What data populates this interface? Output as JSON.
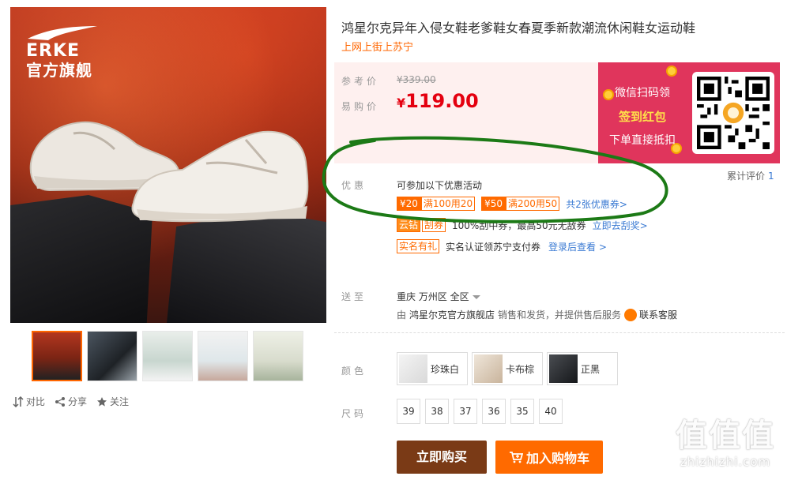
{
  "gallery": {
    "brand_name": "ERKE",
    "brand_flagship": "官方旗舰",
    "thumbnail_count": 5,
    "selected_thumbnail": 1
  },
  "actions": {
    "compare": "对比",
    "share": "分享",
    "follow": "关注"
  },
  "product": {
    "title": "鸿星尔克异年入侵女鞋老爹鞋女春夏季新款潮流休闲鞋女运动鞋",
    "subtitle": "上网上街上苏宁"
  },
  "price": {
    "ref_label": "参考价",
    "ref_value": "¥339.00",
    "buy_label": "易购价",
    "currency": "¥",
    "buy_value": "119.00"
  },
  "promo_banner": {
    "line1": "微信扫码领",
    "line2": "签到红包",
    "line3": "下单直接抵扣"
  },
  "rating": {
    "label": "累计评价",
    "count": "1"
  },
  "promotions": {
    "label": "优惠",
    "intro": "可参加以下优惠活动",
    "coupons": [
      {
        "amount": "¥20",
        "condition": "满100用20"
      },
      {
        "amount": "¥50",
        "condition": "满200用50"
      }
    ],
    "more_coupons": "共2张优惠券>",
    "scratch_tag1": "云钻",
    "scratch_tag2": "刮券",
    "scratch_text": "100%刮中券，最高50元无敌券",
    "scratch_link": "立即去刮奖>",
    "real_name_tag": "实名有礼",
    "real_name_text": "实名认证领苏宁支付券",
    "real_name_link": "登录后查看 >"
  },
  "shipping": {
    "label": "送至",
    "location": "重庆  万州区  全区",
    "by": "由",
    "store": "鸿星尔克官方旗舰店",
    "note": "销售和发货，并提供售后服务",
    "service": "联系客服"
  },
  "colors": {
    "label": "颜色",
    "options": [
      "珍珠白",
      "卡布棕",
      "正黑"
    ]
  },
  "sizes": {
    "label": "尺码",
    "options": [
      "39",
      "38",
      "37",
      "36",
      "35",
      "40"
    ]
  },
  "buttons": {
    "buy_now": "立即购买",
    "add_to_cart": "加入购物车"
  },
  "watermark": {
    "logo": "值值值",
    "url": "zhizhizhi.com"
  },
  "theme": {
    "accent": "#ff6a00",
    "price_red": "#e4000f",
    "buy_button": "#7a3a16",
    "link_blue": "#3a7ad3",
    "banner_pink": "#e0355c",
    "annotation_green": "#1c7a16"
  }
}
